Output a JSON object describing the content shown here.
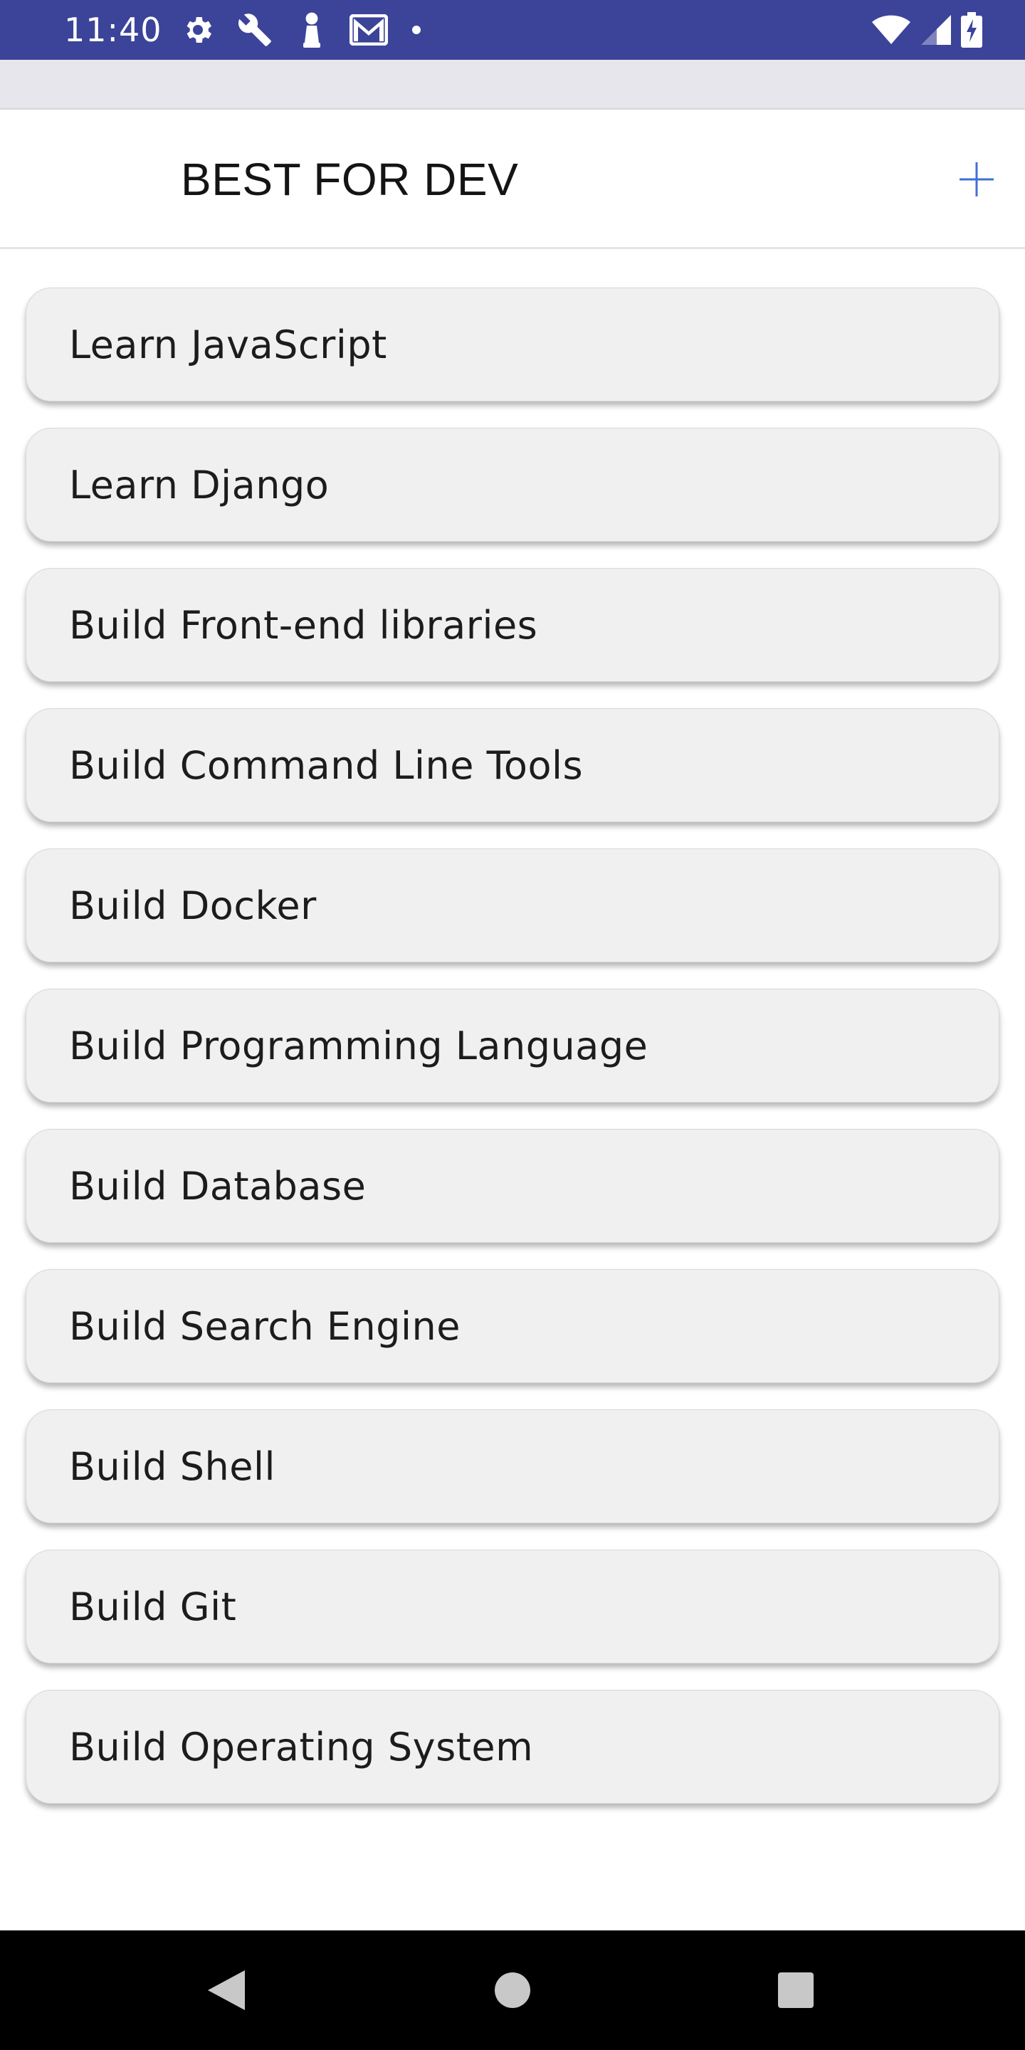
{
  "status_bar": {
    "time": "11:40",
    "left_icons": [
      "gear-icon",
      "wrench-icon",
      "chess-pawn-icon",
      "gmail-icon",
      "dot-icon"
    ],
    "right_icons": [
      "wifi-icon",
      "cellular-signal-icon",
      "battery-charging-icon"
    ],
    "color": "#3b4499"
  },
  "header": {
    "title": "BEST FOR DEV",
    "add_icon": "plus-icon",
    "accent_color": "#3f6fd6"
  },
  "tasks": [
    {
      "label": "Learn JavaScript"
    },
    {
      "label": "Learn Django"
    },
    {
      "label": "Build Front-end libraries"
    },
    {
      "label": "Build Command Line Tools"
    },
    {
      "label": "Build Docker"
    },
    {
      "label": "Build Programming Language"
    },
    {
      "label": "Build Database"
    },
    {
      "label": "Build Search Engine"
    },
    {
      "label": "Build Shell"
    },
    {
      "label": "Build Git"
    },
    {
      "label": "Build Operating System"
    }
  ],
  "nav_bar": {
    "buttons": [
      "back-icon",
      "home-icon",
      "recents-icon"
    ]
  }
}
